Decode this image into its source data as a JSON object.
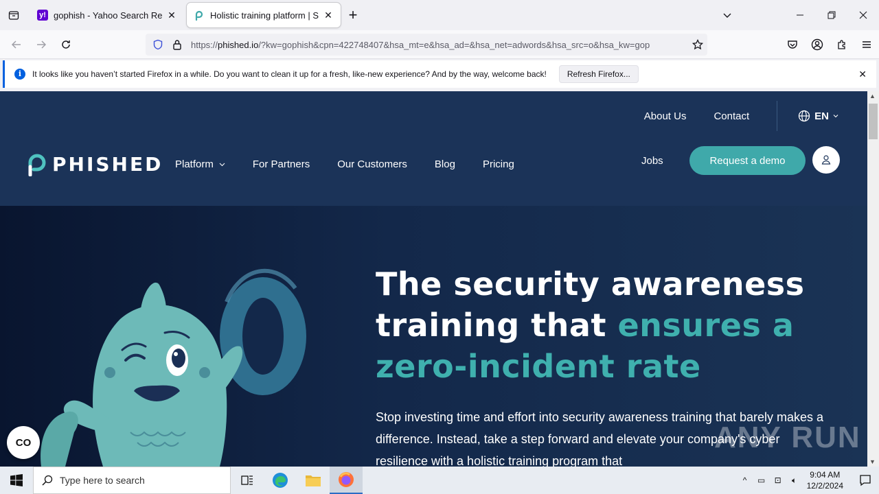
{
  "browser": {
    "tabs": [
      {
        "title": "gophish - Yahoo Search Results",
        "favicon": "yahoo-icon",
        "active": false
      },
      {
        "title": "Holistic training platform | Secu",
        "favicon": "phished-icon",
        "active": true
      }
    ],
    "url_prefix": "https://",
    "url_domain": "phished.io",
    "url_rest": "/?kw=gophish&cpn=422748407&hsa_mt=e&hsa_ad=&hsa_net=adwords&hsa_src=o&hsa_kw=gop",
    "notification": {
      "message": "It looks like you haven’t started Firefox in a while. Do you want to clean it up for a fresh, like-new experience? And by the way, welcome back!",
      "button": "Refresh Firefox..."
    }
  },
  "site": {
    "top_links": {
      "about": "About Us",
      "contact": "Contact",
      "language": "EN"
    },
    "logo_text": "PHISHED",
    "nav": {
      "platform": "Platform",
      "partners": "For Partners",
      "customers": "Our Customers",
      "blog": "Blog",
      "pricing": "Pricing"
    },
    "jobs": "Jobs",
    "cta": "Request a demo",
    "hero": {
      "headline_line1": "The security awareness",
      "headline_line2_plain": "training that ",
      "headline_line2_accent": "ensures a",
      "headline_line3_accent": "zero-incident rate",
      "subtext": "Stop investing time and effort into security awareness training that barely makes a difference. Instead, take a step forward and elevate your company's cyber resilience with a holistic training program that"
    },
    "cookie_button": "CO",
    "watermark": "ANY RUN",
    "colors": {
      "header": "#1b3358",
      "accent": "#3fa9aa",
      "hero_bg": "#0e1a36"
    }
  },
  "taskbar": {
    "search_placeholder": "Type here to search",
    "time": "9:04 AM",
    "date": "12/2/2024"
  }
}
